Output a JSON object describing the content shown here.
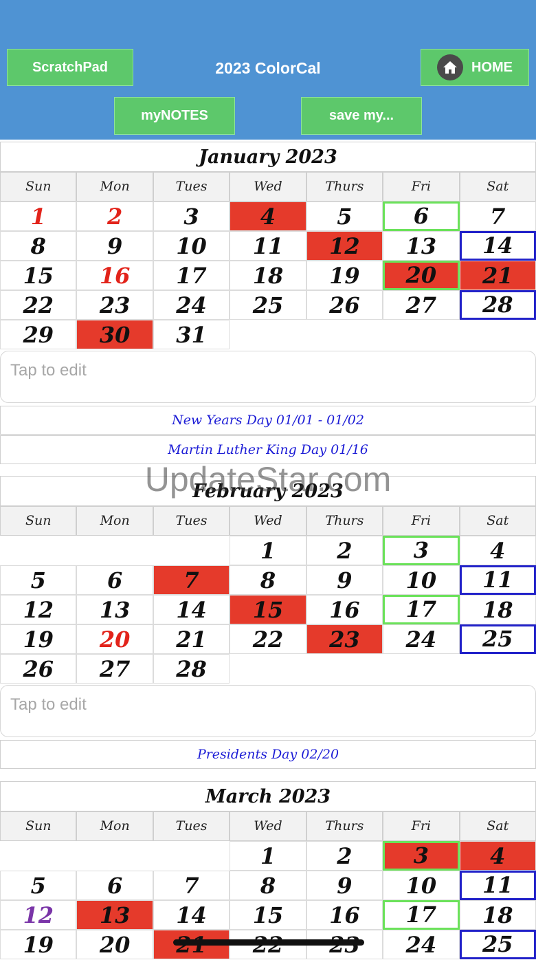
{
  "header": {
    "title": "2023 ColorCal",
    "scratchpad_label": "ScratchPad",
    "home_label": "HOME",
    "mynotes_label": "myNOTES",
    "save_label": "save my..."
  },
  "weekdays": [
    "Sun",
    "Mon",
    "Tues",
    "Wed",
    "Thurs",
    "Fri",
    "Sat"
  ],
  "months": [
    {
      "title": "January 2023",
      "weeks": [
        [
          "1",
          "2",
          "3",
          "4",
          "5",
          "6",
          "7"
        ],
        [
          "8",
          "9",
          "10",
          "11",
          "12",
          "13",
          "14"
        ],
        [
          "15",
          "16",
          "17",
          "18",
          "19",
          "20",
          "21"
        ],
        [
          "22",
          "23",
          "24",
          "25",
          "26",
          "27",
          "28"
        ],
        [
          "29",
          "30",
          "31",
          "",
          "",
          "",
          ""
        ]
      ],
      "note_placeholder": "Tap to edit",
      "holidays": [
        "New Years Day 01/01 - 01/02",
        "Martin Luther King Day 01/16"
      ]
    },
    {
      "title": "February 2023",
      "weeks": [
        [
          "",
          "",
          "",
          "1",
          "2",
          "3",
          "4"
        ],
        [
          "5",
          "6",
          "7",
          "8",
          "9",
          "10",
          "11"
        ],
        [
          "12",
          "13",
          "14",
          "15",
          "16",
          "17",
          "18"
        ],
        [
          "19",
          "20",
          "21",
          "22",
          "23",
          "24",
          "25"
        ],
        [
          "26",
          "27",
          "28",
          "",
          "",
          "",
          ""
        ]
      ],
      "note_placeholder": "Tap to edit",
      "holidays": [
        "Presidents Day 02/20"
      ]
    },
    {
      "title": "March 2023",
      "weeks": [
        [
          "",
          "",
          "",
          "1",
          "2",
          "3",
          "4"
        ],
        [
          "5",
          "6",
          "7",
          "8",
          "9",
          "10",
          "11"
        ],
        [
          "12",
          "13",
          "14",
          "15",
          "16",
          "17",
          "18"
        ],
        [
          "19",
          "20",
          "21",
          "22",
          "23",
          "24",
          "25"
        ]
      ]
    }
  ],
  "watermark": "UpdateStar.com",
  "colors": {
    "header_bg": "#4f93d3",
    "button_bg": "#5dc86b",
    "highlight_red": "#e53a2b",
    "holiday_text": "#1d1dd6",
    "green_border": "#6be25a",
    "blue_border": "#2222c9"
  }
}
